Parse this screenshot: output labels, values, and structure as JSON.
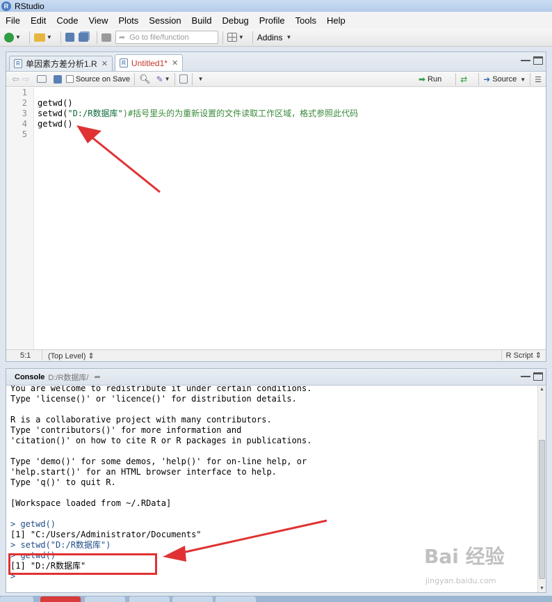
{
  "window": {
    "title": "RStudio"
  },
  "menu": [
    "File",
    "Edit",
    "Code",
    "View",
    "Plots",
    "Session",
    "Build",
    "Debug",
    "Profile",
    "Tools",
    "Help"
  ],
  "toolbar": {
    "goto_placeholder": "Go to file/function",
    "addins_label": "Addins"
  },
  "editor": {
    "tabs": [
      {
        "label": "单因素方差分析1.R",
        "modified": false
      },
      {
        "label": "Untitled1*",
        "modified": true
      }
    ],
    "source_on_save_label": "Source on Save",
    "run_label": "Run",
    "source_label": "Source",
    "line_numbers": [
      "1",
      "2",
      "3",
      "4",
      "5"
    ],
    "lines": [
      {
        "code": "",
        "string": "",
        "comment": "",
        "tail": ""
      },
      {
        "code": "getwd()",
        "string": "",
        "comment": "",
        "tail": ""
      },
      {
        "code": "setwd(",
        "string": "\"D:/R数据库\"",
        "comment": ")#括号里头的为重新设置的文件读取工作区域，格式参照此代码",
        "tail": ""
      },
      {
        "code": "getwd()",
        "string": "",
        "comment": "",
        "tail": ""
      },
      {
        "code": "",
        "string": "",
        "comment": "",
        "tail": ""
      }
    ],
    "status": {
      "position": "5:1",
      "scope": "(Top Level) ⇕",
      "file_type": "R Script ⇕"
    }
  },
  "console": {
    "title": "Console",
    "path": "D:/R数据库/",
    "lines": [
      {
        "prompt": "",
        "text": "You are welcome to redistribute it under certain conditions."
      },
      {
        "prompt": "",
        "text": "Type 'license()' or 'licence()' for distribution details."
      },
      {
        "prompt": "",
        "text": ""
      },
      {
        "prompt": "",
        "text": "R is a collaborative project with many contributors."
      },
      {
        "prompt": "",
        "text": "Type 'contributors()' for more information and"
      },
      {
        "prompt": "",
        "text": "'citation()' on how to cite R or R packages in publications."
      },
      {
        "prompt": "",
        "text": ""
      },
      {
        "prompt": "",
        "text": "Type 'demo()' for some demos, 'help()' for on-line help, or"
      },
      {
        "prompt": "",
        "text": "'help.start()' for an HTML browser interface to help."
      },
      {
        "prompt": "",
        "text": "Type 'q()' to quit R."
      },
      {
        "prompt": "",
        "text": ""
      },
      {
        "prompt": "",
        "text": "[Workspace loaded from ~/.RData]"
      },
      {
        "prompt": "",
        "text": ""
      },
      {
        "prompt": ">",
        "text": " getwd()"
      },
      {
        "prompt": "",
        "text": "[1] \"C:/Users/Administrator/Documents\""
      },
      {
        "prompt": ">",
        "text": " setwd(\"D:/R数据库\")"
      },
      {
        "prompt": ">",
        "text": " getwd()"
      },
      {
        "prompt": "",
        "text": "[1] \"D:/R数据库\""
      },
      {
        "prompt": ">",
        "text": ""
      }
    ]
  },
  "watermark": {
    "main": "Bai 经验",
    "sub": "jingyan.baidu.com"
  },
  "colors": {
    "annotation": "#e03232",
    "prompt": "#1f4d8a",
    "string": "#0b6b3a"
  }
}
